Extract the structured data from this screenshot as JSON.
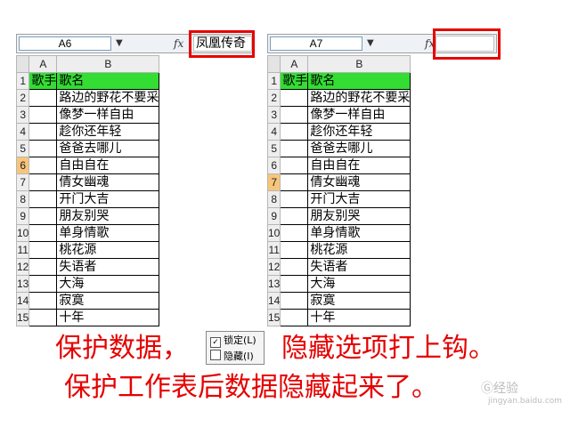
{
  "left": {
    "name_box": "A6",
    "formula_value": "凤凰传奇",
    "dropdown_glyph": "▼",
    "fx_label": "fx",
    "col_headers": [
      "A",
      "B"
    ],
    "selected_row": 6,
    "rows": [
      {
        "num": "1",
        "a": "歌手",
        "b": "歌名"
      },
      {
        "num": "2",
        "a": "",
        "b": "路边的野花不要采"
      },
      {
        "num": "3",
        "a": "",
        "b": "像梦一样自由"
      },
      {
        "num": "4",
        "a": "",
        "b": "趁你还年轻"
      },
      {
        "num": "5",
        "a": "",
        "b": "爸爸去哪儿"
      },
      {
        "num": "6",
        "a": "",
        "b": "自由自在"
      },
      {
        "num": "7",
        "a": "",
        "b": "倩女幽魂"
      },
      {
        "num": "8",
        "a": "",
        "b": "开门大吉"
      },
      {
        "num": "9",
        "a": "",
        "b": "朋友别哭"
      },
      {
        "num": "10",
        "a": "",
        "b": "单身情歌"
      },
      {
        "num": "11",
        "a": "",
        "b": "桃花源"
      },
      {
        "num": "12",
        "a": "",
        "b": "失语者"
      },
      {
        "num": "13",
        "a": "",
        "b": "大海"
      },
      {
        "num": "14",
        "a": "",
        "b": "寂寞"
      },
      {
        "num": "15",
        "a": "",
        "b": "十年"
      }
    ]
  },
  "right": {
    "name_box": "A7",
    "formula_value": "",
    "dropdown_glyph": "▼",
    "fx_label": "fx",
    "col_headers": [
      "A",
      "B"
    ],
    "selected_row": 7,
    "rows": [
      {
        "num": "1",
        "a": "歌手",
        "b": "歌名"
      },
      {
        "num": "2",
        "a": "",
        "b": "路边的野花不要采"
      },
      {
        "num": "3",
        "a": "",
        "b": "像梦一样自由"
      },
      {
        "num": "4",
        "a": "",
        "b": "趁你还年轻"
      },
      {
        "num": "5",
        "a": "",
        "b": "爸爸去哪儿"
      },
      {
        "num": "6",
        "a": "",
        "b": "自由自在"
      },
      {
        "num": "7",
        "a": "",
        "b": "倩女幽魂"
      },
      {
        "num": "8",
        "a": "",
        "b": "开门大吉"
      },
      {
        "num": "9",
        "a": "",
        "b": "朋友别哭"
      },
      {
        "num": "10",
        "a": "",
        "b": "单身情歌"
      },
      {
        "num": "11",
        "a": "",
        "b": "桃花源"
      },
      {
        "num": "12",
        "a": "",
        "b": "失语者"
      },
      {
        "num": "13",
        "a": "",
        "b": "大海"
      },
      {
        "num": "14",
        "a": "",
        "b": "寂寞"
      },
      {
        "num": "15",
        "a": "",
        "b": "十年"
      }
    ]
  },
  "protection": {
    "locked_label": "锁定(L)",
    "locked_checked": true,
    "hidden_label": "隐藏(I)",
    "hidden_checked": false,
    "check_glyph": "✓"
  },
  "captions": {
    "line1_left": "保护数据，",
    "line1_right": "隐藏选项打上钩。",
    "line2": "保护工作表后数据隐藏起来了。"
  },
  "watermark": {
    "main": "Ⓖ经验",
    "sub": "jingyan.baidu.com"
  },
  "colors": {
    "header_fill": "#33dd33",
    "highlight": "#e60000",
    "selected_row_header": "#f7c57a"
  }
}
